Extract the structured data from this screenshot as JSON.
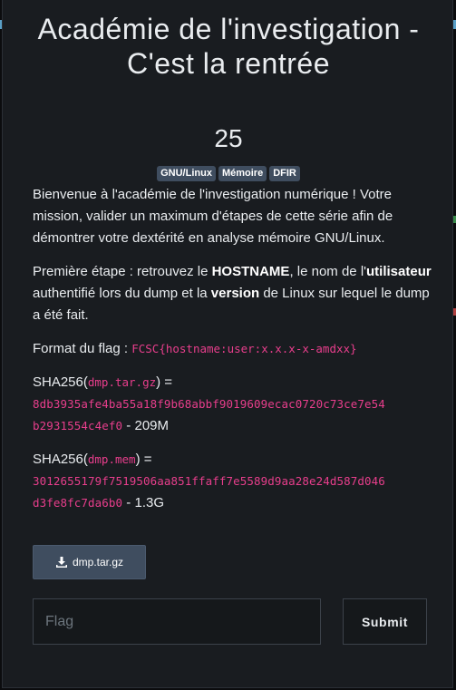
{
  "challenge": {
    "title": "Académie de l'investigation - C'est la rentrée",
    "value": "25",
    "tags": [
      "GNU/Linux",
      "Mémoire",
      "DFIR"
    ]
  },
  "description": {
    "intro": "Bienvenue à l'académie de l'investigation numérique ! Votre mission, valider un maximum d'étapes de cette série afin de démontrer votre dextérité en analyse mémoire GNU/Linux.",
    "step": {
      "prefix": "Première étape : retrouvez le ",
      "hostname": "HOSTNAME",
      "mid1": ", le nom de l'",
      "user": "utilisateur",
      "mid2": " authentifié lors du dump et la ",
      "version": "version",
      "suffix": " de Linux sur lequel le dump a été fait."
    },
    "flag_format": {
      "label": "Format du flag : ",
      "value": "FCSC{hostname:user:x.x.x-x-amdxx}"
    },
    "files": [
      {
        "prefix": "SHA256(",
        "name": "dmp.tar.gz",
        "suffix": ") =",
        "hash_line1": "8db3935afe4ba55a18f9b68abbf9019609ecac0720c73ce7e54",
        "hash_line2": "b2931554c4ef0",
        "size": " - 209M"
      },
      {
        "prefix": "SHA256(",
        "name": "dmp.mem",
        "suffix": ") =",
        "hash_line1": "3012655179f7519506aa851ffaff7e5589d9aa28e24d587d046",
        "hash_line2": "d3fe8fc7da6b0",
        "size": " - 1.3G"
      }
    ]
  },
  "download": {
    "label": "dmp.tar.gz",
    "icon": "download-icon"
  },
  "form": {
    "placeholder": "Flag",
    "value": "",
    "submit_label": "Submit"
  },
  "colors": {
    "background": "#191c20",
    "tag": "#3f4d5f",
    "code": "#e83e8c",
    "text": "#e9ecef"
  }
}
